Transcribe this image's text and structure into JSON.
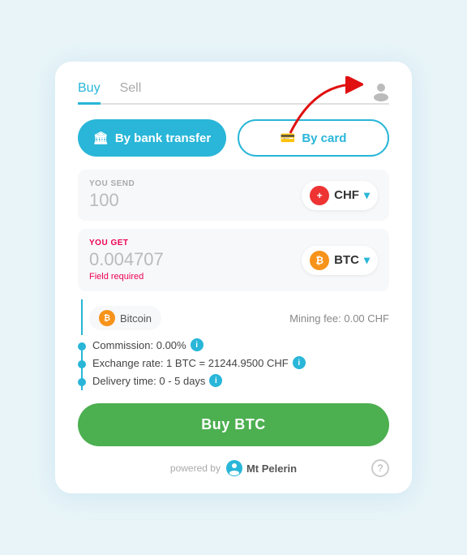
{
  "tabs": {
    "buy": "Buy",
    "sell": "Sell"
  },
  "payment": {
    "bank_label": "By bank transfer",
    "card_label": "By card"
  },
  "send": {
    "label": "YOU SEND",
    "value": "100",
    "currency": "CHF"
  },
  "get": {
    "label": "YOU GET",
    "value": "0.004707",
    "currency": "BTC",
    "field_required": "Field required"
  },
  "bitcoin": {
    "name": "Bitcoin",
    "mining_fee": "Mining fee: 0.00 CHF"
  },
  "details": {
    "commission": "Commission: 0.00%",
    "exchange_rate": "Exchange rate: 1 BTC = 21244.9500 CHF",
    "delivery": "Delivery time: 0 - 5 days"
  },
  "buy_button": "Buy BTC",
  "footer": {
    "powered_by": "powered by",
    "brand": "Mt Pelerin"
  },
  "icons": {
    "bank": "🏛",
    "card": "💳",
    "chf": "+",
    "btc": "₿",
    "info": "i",
    "question": "?",
    "profile": "👤"
  }
}
